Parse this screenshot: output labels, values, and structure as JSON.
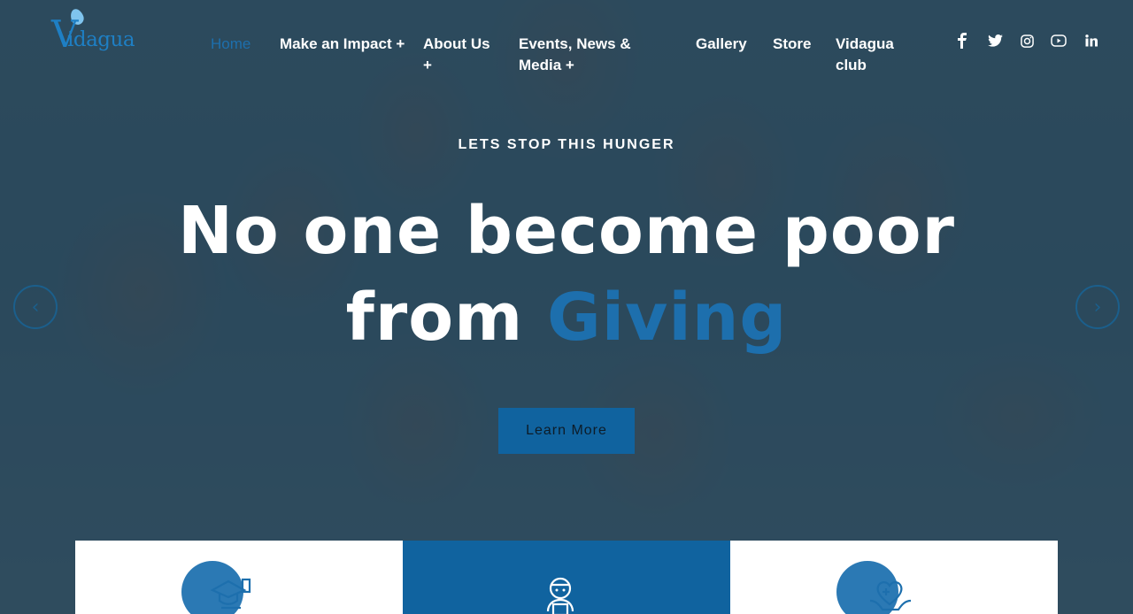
{
  "brand": {
    "logo_text": "idagua",
    "logo_initial": "V",
    "logo_alt": "Vidagua"
  },
  "nav": [
    {
      "label": "Home",
      "active": true
    },
    {
      "label": "Make an Impact +"
    },
    {
      "label": "About Us +"
    },
    {
      "label": "Events, News & Media +"
    },
    {
      "label": "Gallery"
    },
    {
      "label": "Store"
    },
    {
      "label": "Vidagua club"
    }
  ],
  "social": [
    "facebook-icon",
    "twitter-icon",
    "instagram-icon",
    "youtube-icon",
    "linkedin-icon"
  ],
  "hero": {
    "eyebrow": "LETS STOP THIS HUNGER",
    "headline_line1": "No one become poor",
    "headline_line2_prefix": "from",
    "headline_accent": "Giving",
    "cta_label": "Learn More"
  },
  "carousel": {
    "prev_icon": "chevron-left-icon",
    "next_icon": "chevron-right-icon"
  },
  "cards": [
    {
      "icon": "graduation-hand-icon",
      "style": "white"
    },
    {
      "icon": "person-icon",
      "style": "blue"
    },
    {
      "icon": "heart-hand-icon",
      "style": "white"
    }
  ],
  "colors": {
    "accent": "#1d6fad",
    "button": "#10639f",
    "overlay": "#193a52"
  }
}
